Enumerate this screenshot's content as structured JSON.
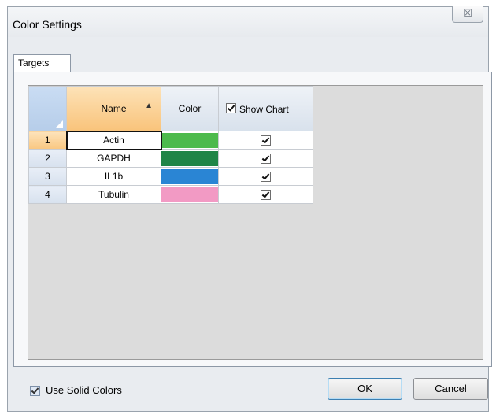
{
  "window": {
    "title": "Color Settings",
    "close_glyph": "☒"
  },
  "tabs": [
    {
      "label": "Targets",
      "active": true
    }
  ],
  "grid": {
    "columns": {
      "name": "Name",
      "color": "Color",
      "show_chart": "Show Chart"
    },
    "sort_indicator": "▲",
    "header_show_chart_checked": true,
    "rows": [
      {
        "num": "1",
        "name": "Actin",
        "color": "#4cba4c",
        "show": true
      },
      {
        "num": "2",
        "name": "GAPDH",
        "color": "#1f8547",
        "show": true
      },
      {
        "num": "3",
        "name": "IL1b",
        "color": "#2a85d4",
        "show": true
      },
      {
        "num": "4",
        "name": "Tubulin",
        "color": "#f29ac4",
        "show": true
      }
    ]
  },
  "footer": {
    "use_solid_colors_label": "Use Solid Colors",
    "use_solid_colors_checked": true,
    "ok_label": "OK",
    "cancel_label": "Cancel"
  }
}
